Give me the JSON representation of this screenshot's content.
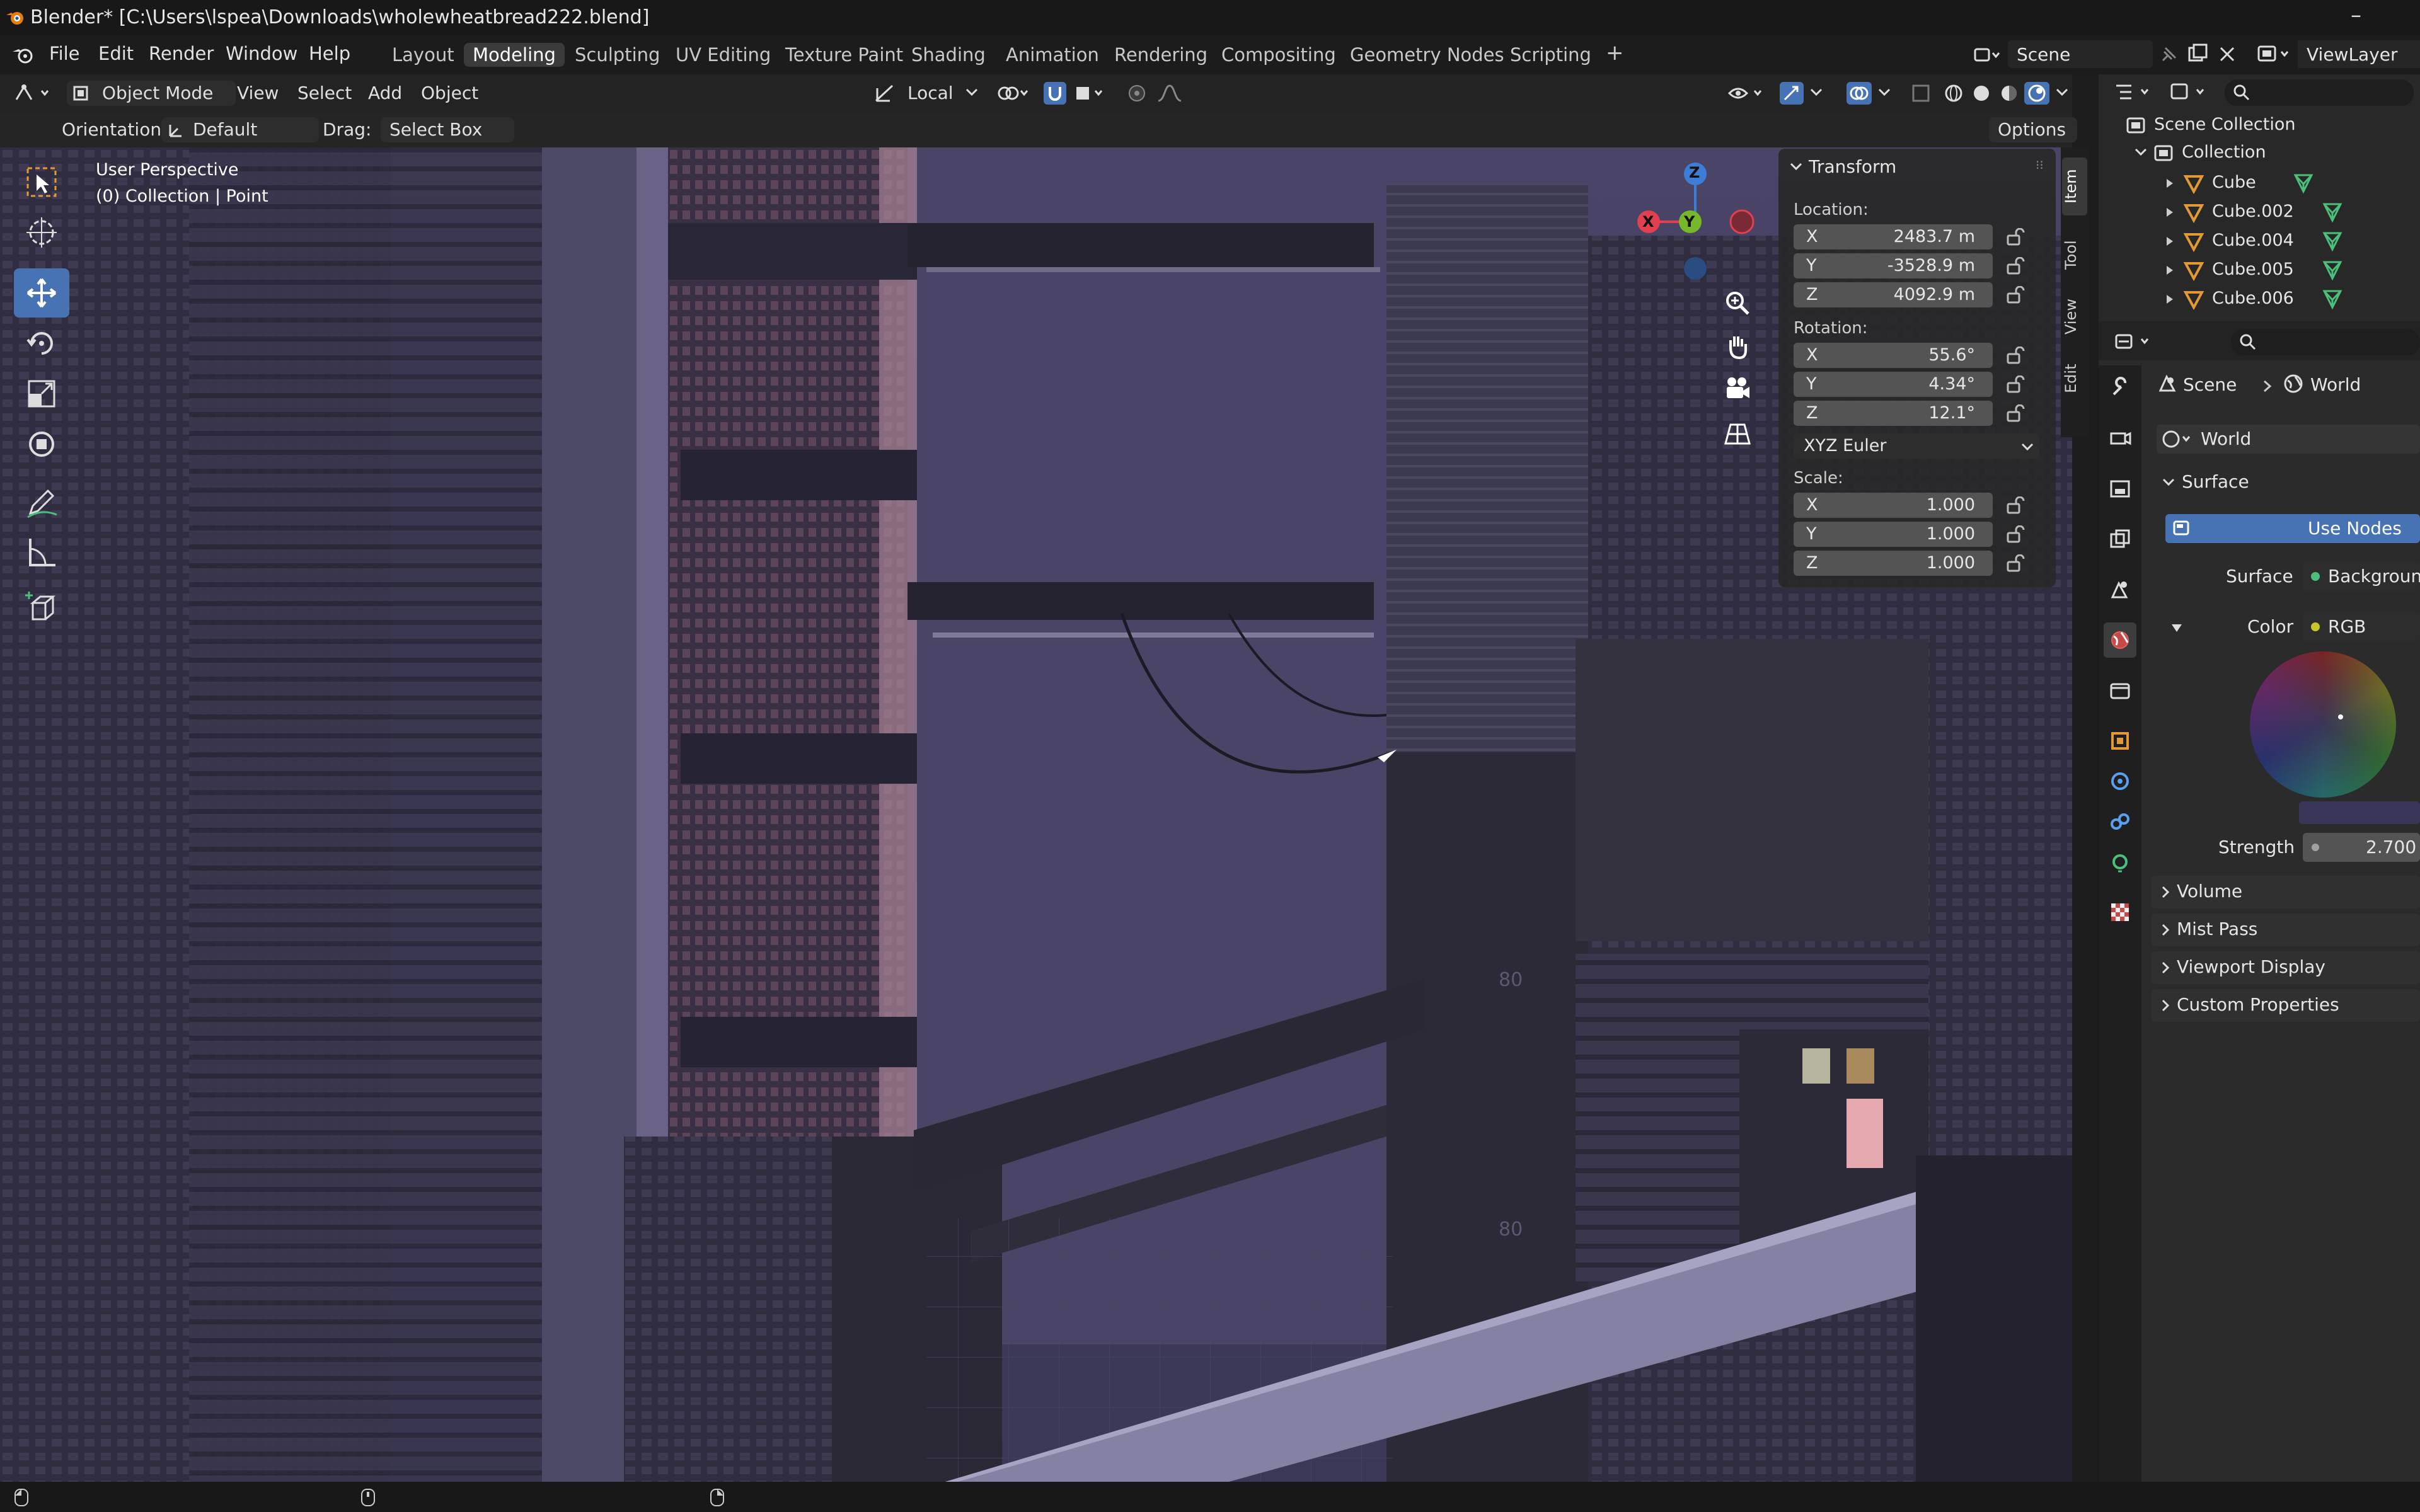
{
  "titlebar": {
    "title": "Blender* [C:\\Users\\lspea\\Downloads\\wholewheatbread222.blend]",
    "minimize": "–"
  },
  "menubar": {
    "menus": [
      "File",
      "Edit",
      "Render",
      "Window",
      "Help"
    ],
    "workspaces": [
      "Layout",
      "Modeling",
      "Sculpting",
      "UV Editing",
      "Texture Paint",
      "Shading",
      "Animation",
      "Rendering",
      "Compositing",
      "Geometry Nodes",
      "Scripting"
    ],
    "active_workspace": "Modeling",
    "add_tab": "+",
    "scene": "Scene",
    "view_layer": "ViewLayer"
  },
  "viewport_header": {
    "mode": "Object Mode",
    "menus": [
      "View",
      "Select",
      "Add",
      "Object"
    ],
    "transform_space": "Local"
  },
  "tool_settings": {
    "orientation_label": "Orientation:",
    "orientation_value": "Default",
    "drag_label": "Drag:",
    "drag_value": "Select Box",
    "options": "Options"
  },
  "viewport": {
    "perspective": "User Perspective",
    "collection_info": "(0) Collection | Point",
    "sign_text_1": "80",
    "sign_text_2": "80"
  },
  "gizmo": {
    "z": "Z",
    "y": "Y",
    "x": "X"
  },
  "transform_panel": {
    "title": "Transform",
    "location_label": "Location:",
    "location": [
      {
        "axis": "X",
        "value": "2483.7 m"
      },
      {
        "axis": "Y",
        "value": "-3528.9 m"
      },
      {
        "axis": "Z",
        "value": "4092.9 m"
      }
    ],
    "rotation_label": "Rotation:",
    "rotation": [
      {
        "axis": "X",
        "value": "55.6°"
      },
      {
        "axis": "Y",
        "value": "4.34°"
      },
      {
        "axis": "Z",
        "value": "12.1°"
      }
    ],
    "rotation_mode": "XYZ Euler",
    "scale_label": "Scale:",
    "scale": [
      {
        "axis": "X",
        "value": "1.000"
      },
      {
        "axis": "Y",
        "value": "1.000"
      },
      {
        "axis": "Z",
        "value": "1.000"
      }
    ]
  },
  "sidebar_tabs": [
    "Item",
    "Tool",
    "View",
    "Edit"
  ],
  "outliner": {
    "root": "Scene Collection",
    "collection": "Collection",
    "items": [
      "Cube",
      "Cube.002",
      "Cube.004",
      "Cube.005",
      "Cube.006"
    ]
  },
  "properties": {
    "breadcrumb": [
      "Scene",
      "World"
    ],
    "world_name": "World",
    "surface_panel": "Surface",
    "use_nodes": "Use Nodes",
    "surface_label": "Surface",
    "surface_value": "Background",
    "color_label": "Color",
    "color_value": "RGB",
    "strength_label": "Strength",
    "strength_value": "2.700",
    "collapsed_panels": [
      "Volume",
      "Mist Pass",
      "Viewport Display",
      "Custom Properties"
    ]
  },
  "colors": {
    "accent": "#4772b3",
    "x_axis": "#e0404f",
    "y_axis": "#76b82a",
    "z_axis": "#3d7dd6",
    "selection_orange": "#e39a33"
  }
}
